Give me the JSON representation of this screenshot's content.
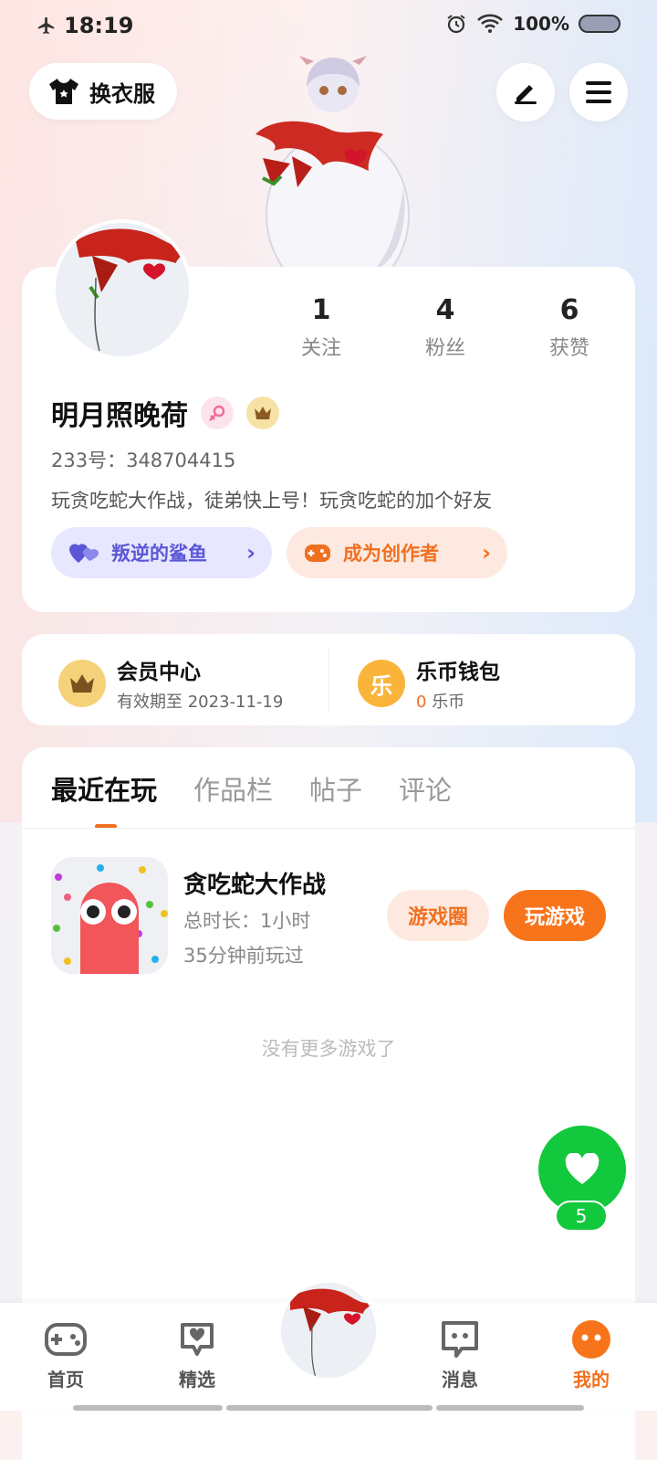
{
  "status_bar": {
    "time": "18:19",
    "battery": "100%"
  },
  "header": {
    "outfit_label": "换衣服"
  },
  "profile": {
    "stats": [
      {
        "value": "1",
        "label": "关注"
      },
      {
        "value": "4",
        "label": "粉丝"
      },
      {
        "value": "6",
        "label": "获赞"
      }
    ],
    "username": "明月照晚荷",
    "uid_label": "233号：348704415",
    "bio": "玩贪吃蛇大作战，徒弟快上号！玩贪吃蛇的加个好友",
    "tag_button": "叛逆的鲨鱼",
    "creator_button": "成为创作者"
  },
  "membership": {
    "vip_title": "会员中心",
    "vip_sub": "有效期至 2023-11-19",
    "wallet_title": "乐币钱包",
    "wallet_amount": "0",
    "wallet_unit": "乐币",
    "coin_glyph": "乐"
  },
  "tabs": [
    "最近在玩",
    "作品栏",
    "帖子",
    "评论"
  ],
  "recent_game": {
    "name": "贪吃蛇大作战",
    "duration": "总时长：1小时",
    "last_played": "35分钟前玩过",
    "circle_button": "游戏圈",
    "play_button": "玩游戏"
  },
  "no_more_text": "没有更多游戏了",
  "like_count": "5",
  "bottom_nav": [
    {
      "label": "首页",
      "icon": "gamepad-icon"
    },
    {
      "label": "精选",
      "icon": "heart-chat-icon"
    },
    {
      "label": "消息",
      "icon": "message-icon"
    },
    {
      "label": "我的",
      "icon": "profile-face-icon"
    }
  ],
  "colors": {
    "accent": "#f07020",
    "purple": "#5a56d6",
    "green": "#12c83c"
  }
}
